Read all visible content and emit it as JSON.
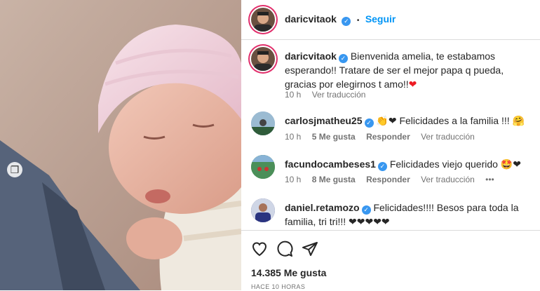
{
  "post": {
    "author": "daricvitaok",
    "follow_label": "Seguir",
    "dot_separator": "•",
    "caption": "Bienvenida amelia, te estabamos esperando!! Tratare de ser el mejor papa q pueda, gracias por elegirnos t amo!!",
    "caption_emoji": "❤",
    "caption_time": "10 h",
    "caption_translate": "Ver traducción",
    "likes": "14.385 Me gusta",
    "posted": "HACE 10 HORAS",
    "carousel_icon": "gallery-icon"
  },
  "comments": [
    {
      "user": "carlosjmatheu25",
      "text": "👏❤ Felicidades a la familia !!! 🤗",
      "time": "10 h",
      "likes": "5 Me gusta",
      "reply": "Responder",
      "translate": "Ver traducción"
    },
    {
      "user": "facundocambeses1",
      "text": "Felicidades viejo querido 🤩❤",
      "time": "10 h",
      "likes": "8 Me gusta",
      "reply": "Responder",
      "translate": "Ver traducción",
      "more": "•••"
    },
    {
      "user": "daniel.retamozo",
      "text": "Felicidades!!!! Besos para toda la familia, tri tri!!! ❤❤❤❤❤"
    }
  ],
  "colors": {
    "link": "#0095f6",
    "verified": "#3897f0",
    "heart": "#ed1c24"
  },
  "icons": [
    "heart-icon",
    "comment-icon",
    "share-icon",
    "verified-icon"
  ]
}
